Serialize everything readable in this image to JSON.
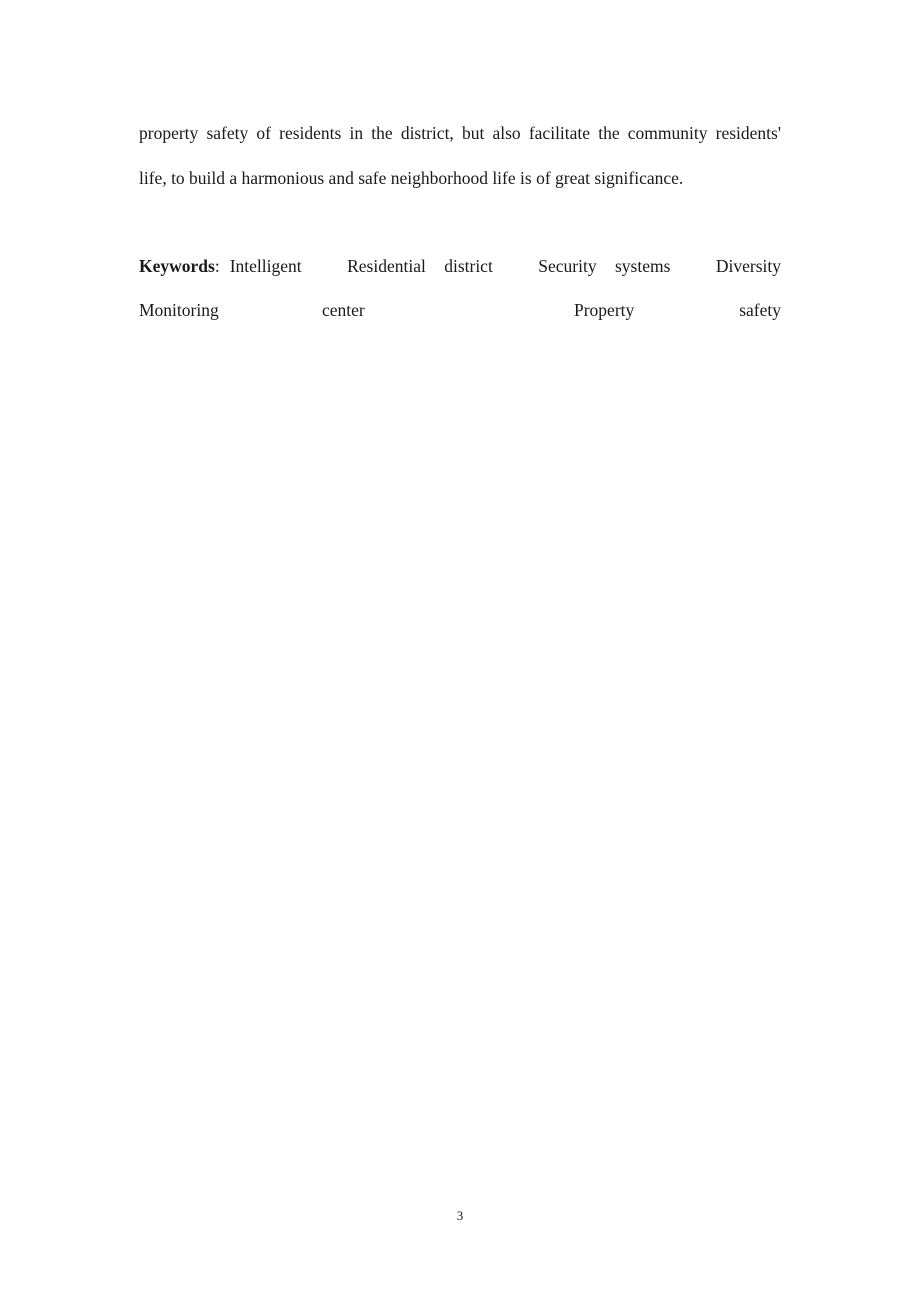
{
  "body": {
    "lines": [
      "property safety of residents in the district, but also facilitate the community residents'",
      "life, to build a harmonious and safe neighborhood life is of great significance."
    ]
  },
  "keywords": {
    "label": "Keywords",
    "separator": ":",
    "row1": [
      "Intelligent",
      "Residential district",
      "Security systems",
      "Diversity"
    ],
    "row2": [
      "Monitoring",
      "center",
      "Property",
      "safety"
    ]
  },
  "footer": {
    "page_number": "3"
  }
}
